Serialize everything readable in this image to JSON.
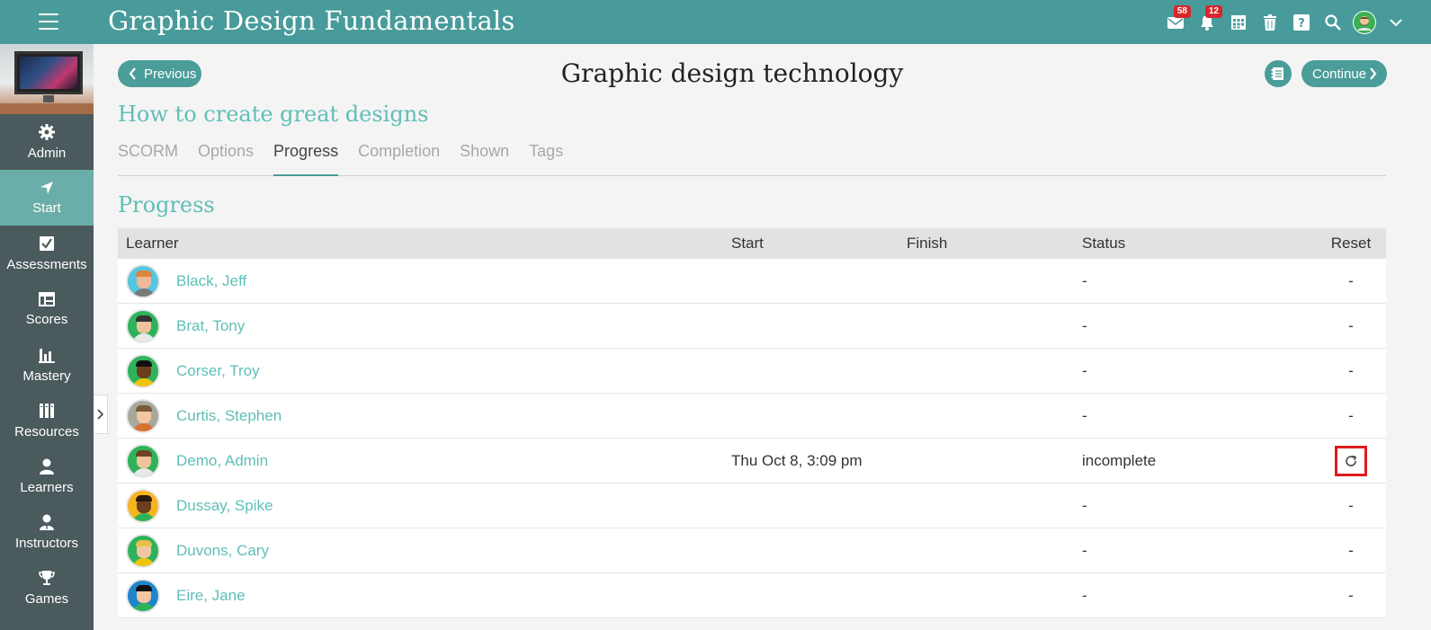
{
  "app": {
    "title": "Graphic Design Fundamentals"
  },
  "topbar": {
    "mail_count": "58",
    "notification_count": "12",
    "icons": [
      "mail-icon",
      "bell-icon",
      "calendar-icon",
      "trash-icon",
      "help-icon",
      "search-icon",
      "user-avatar",
      "chevron-down-icon"
    ]
  },
  "sidebar": {
    "items": [
      {
        "label": "Admin",
        "icon": "gear-icon"
      },
      {
        "label": "Start",
        "icon": "navigation-arrow-icon",
        "active": true
      },
      {
        "label": "Assessments",
        "icon": "checkbox-icon"
      },
      {
        "label": "Scores",
        "icon": "gradebook-icon"
      },
      {
        "label": "Mastery",
        "icon": "bar-chart-icon"
      },
      {
        "label": "Resources",
        "icon": "books-icon"
      },
      {
        "label": "Learners",
        "icon": "person-icon"
      },
      {
        "label": "Instructors",
        "icon": "instructor-icon"
      },
      {
        "label": "Games",
        "icon": "trophy-icon"
      }
    ]
  },
  "nav": {
    "previous_label": "Previous",
    "continue_label": "Continue"
  },
  "page": {
    "title": "Graphic design technology",
    "subtitle": "How to create great designs",
    "section_title": "Progress"
  },
  "tabs": [
    {
      "label": "SCORM"
    },
    {
      "label": "Options"
    },
    {
      "label": "Progress",
      "active": true
    },
    {
      "label": "Completion"
    },
    {
      "label": "Shown"
    },
    {
      "label": "Tags"
    }
  ],
  "table": {
    "headers": {
      "learner": "Learner",
      "start": "Start",
      "finish": "Finish",
      "status": "Status",
      "reset": "Reset"
    },
    "rows": [
      {
        "name": "Black, Jeff",
        "start": "",
        "finish": "",
        "status": "-",
        "reset": "-"
      },
      {
        "name": "Brat, Tony",
        "start": "",
        "finish": "",
        "status": "-",
        "reset": "-"
      },
      {
        "name": "Corser, Troy",
        "start": "",
        "finish": "",
        "status": "-",
        "reset": "-"
      },
      {
        "name": "Curtis, Stephen",
        "start": "",
        "finish": "",
        "status": "-",
        "reset": "-"
      },
      {
        "name": "Demo, Admin",
        "start": "Thu Oct 8, 3:09 pm",
        "finish": "",
        "status": "incomplete",
        "reset": "reset-icon"
      },
      {
        "name": "Dussay, Spike",
        "start": "",
        "finish": "",
        "status": "-",
        "reset": "-"
      },
      {
        "name": "Duvons, Cary",
        "start": "",
        "finish": "",
        "status": "-",
        "reset": "-"
      },
      {
        "name": "Eire, Jane",
        "start": "",
        "finish": "",
        "status": "-",
        "reset": "-"
      }
    ]
  },
  "colors": {
    "topbar": "#489b9a",
    "accent": "#5fbfb5",
    "sidebar": "#4b5a5c",
    "sidebar_active": "#6aaea9",
    "highlight": "#e01b1b"
  }
}
